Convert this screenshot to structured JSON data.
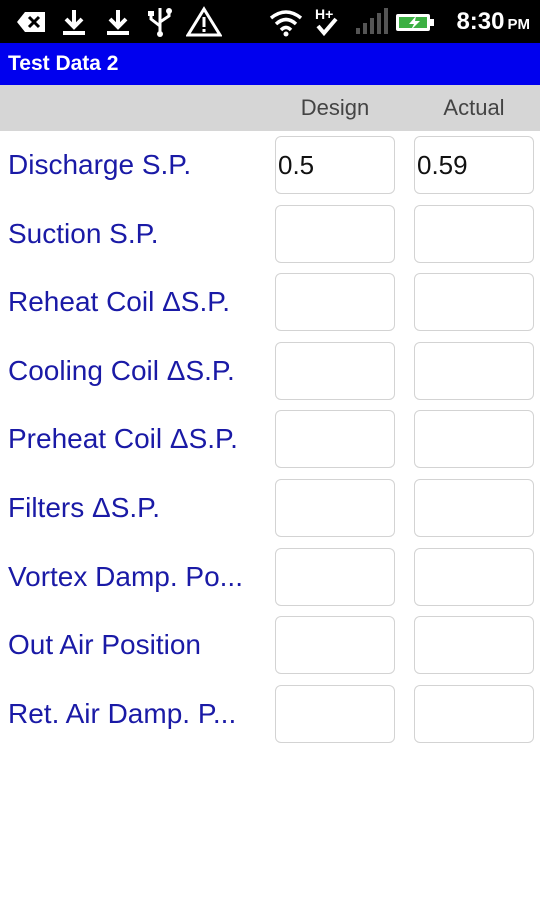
{
  "status_bar": {
    "icons": [
      "usb-debug-icon",
      "download-icon",
      "download-icon",
      "usb-icon",
      "warning-icon",
      "wifi-icon",
      "hspa-data-icon",
      "signal-icon",
      "battery-charging-icon"
    ],
    "time": "8:30",
    "ampm": "PM"
  },
  "app_bar": {
    "title": "Test Data 2",
    "color": "#0000ee"
  },
  "columns": {
    "design": "Design",
    "actual": "Actual"
  },
  "rows": [
    {
      "label": "Discharge S.P.",
      "design": "0.5",
      "actual": "0.59"
    },
    {
      "label": "Suction S.P.",
      "design": "",
      "actual": ""
    },
    {
      "label": "Reheat Coil ΔS.P.",
      "design": "",
      "actual": ""
    },
    {
      "label": "Cooling Coil ΔS.P.",
      "design": "",
      "actual": ""
    },
    {
      "label": "Preheat Coil ΔS.P.",
      "design": "",
      "actual": ""
    },
    {
      "label": "Filters ΔS.P.",
      "design": "",
      "actual": ""
    },
    {
      "label": "Vortex Damp. Po...",
      "design": "",
      "actual": ""
    },
    {
      "label": "Out Air Position",
      "design": "",
      "actual": ""
    },
    {
      "label": "Ret. Air Damp. P...",
      "design": "",
      "actual": ""
    }
  ],
  "colors": {
    "label_text": "#1a1aa6",
    "header_band": "#d6d6d6"
  }
}
